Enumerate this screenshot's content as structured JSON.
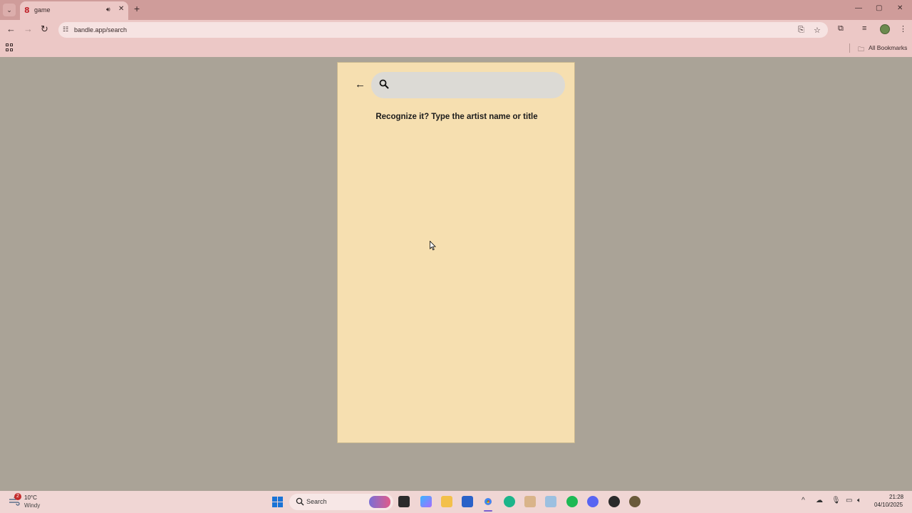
{
  "browser": {
    "tab": {
      "title": "game",
      "favicon": "8"
    },
    "new_tab_icon": "plus-icon",
    "window_controls": {
      "minimize": "—",
      "maximize": "▢",
      "close": "✕"
    },
    "url": "bandle.app/search",
    "bookmarks": {
      "all_bookmarks_label": "All Bookmarks"
    }
  },
  "page": {
    "search": {
      "placeholder": "",
      "value": ""
    },
    "prompt": "Recognize it? Type the artist name or title",
    "background_color": "#aaa397",
    "card_color": "#f6dfb0"
  },
  "taskbar": {
    "weather": {
      "temperature": "10°C",
      "condition": "Windy",
      "badge": "2"
    },
    "search_label": "Search",
    "clock": {
      "time": "21:28",
      "date": "04/10/2025"
    }
  }
}
